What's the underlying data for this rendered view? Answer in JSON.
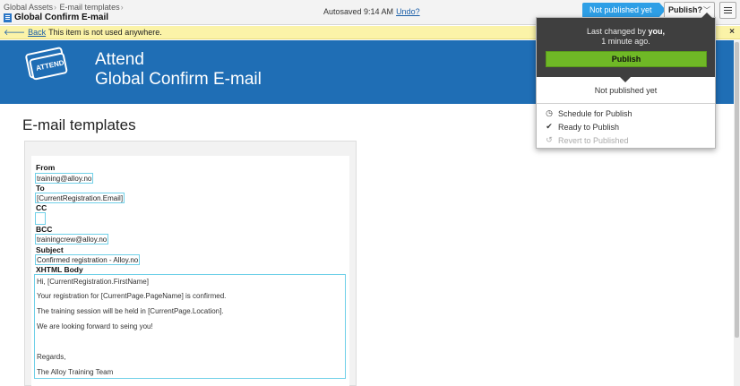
{
  "breadcrumb": [
    "Global Assets",
    "E-mail templates"
  ],
  "page_name": "Global Confirm E-mail",
  "autosave": {
    "text": "Autosaved 9:14 AM",
    "undo": "Undo?"
  },
  "status": "Not published yet",
  "publish_menu": {
    "label": "Publish?"
  },
  "notice": {
    "back": "Back",
    "text": "This item is not used anywhere.",
    "close": "×"
  },
  "banner": {
    "logo_text": "ATTEND",
    "title_line1": "Attend",
    "title_line2": "Global Confirm E-mail"
  },
  "panel": {
    "changed_pre": "Last changed by ",
    "changed_user": "you,",
    "changed_time": "1 minute ago.",
    "publish": "Publish",
    "not_published": "Not published yet",
    "items": [
      {
        "label": "Schedule for Publish",
        "icon": "clock-icon"
      },
      {
        "label": "Ready to Publish",
        "icon": "checkmark-icon"
      },
      {
        "label": "Revert to Published",
        "icon": "revert-icon"
      }
    ]
  },
  "section_heading": "E-mail templates",
  "form": {
    "from_label": "From",
    "from_value": "training@alloy.no",
    "to_label": "To",
    "to_value": "[CurrentRegistration.Email]",
    "cc_label": "CC",
    "cc_value": "",
    "bcc_label": "BCC",
    "bcc_value": "trainingcrew@alloy.no",
    "subject_label": "Subject",
    "subject_value": "Confirmed registration - Alloy.no",
    "body_label": "XHTML Body",
    "body_lines": [
      "Hi, [CurrentRegistration.FirstName]",
      "Your registration for [CurrentPage.PageName] is confirmed.",
      "The training session will be held in [CurrentPage.Location].",
      "We are looking forward to seing you!",
      "Regards,",
      "The Alloy Training Team"
    ]
  },
  "colors": {
    "banner": "#1f6eb5",
    "status": "#2e9fe6",
    "publish": "#6fb826",
    "notice": "#fbf3a8"
  }
}
